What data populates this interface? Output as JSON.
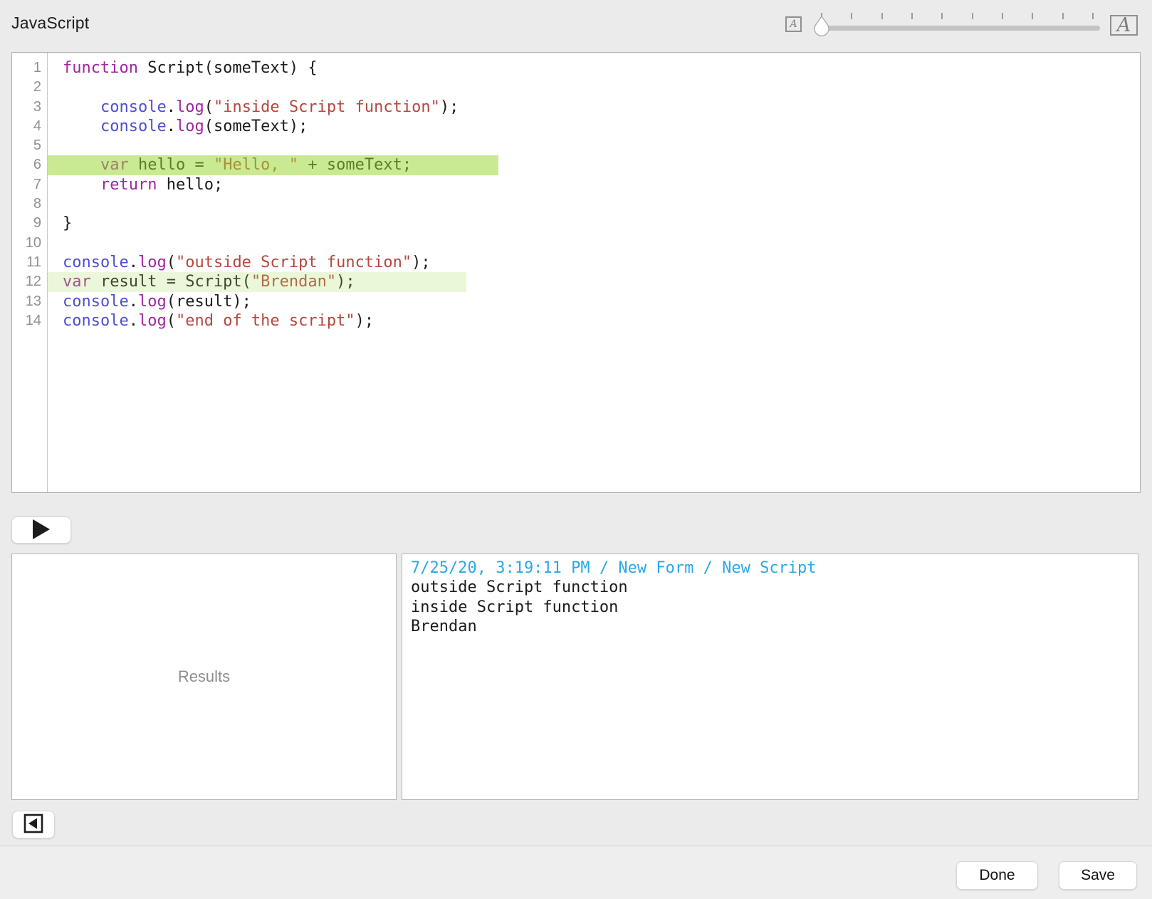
{
  "header": {
    "title": "JavaScript"
  },
  "font_slider": {
    "small_label": "A",
    "large_label": "A",
    "tick_count": 10,
    "thumb_position": "minimum"
  },
  "editor": {
    "language": "JavaScript",
    "lines": [
      {
        "segments": [
          {
            "t": "function",
            "c": "keyword"
          },
          {
            "t": " Script(someText) {",
            "c": "plain"
          }
        ]
      },
      {
        "segments": []
      },
      {
        "segments": [
          {
            "t": "    ",
            "c": "plain"
          },
          {
            "t": "console",
            "c": "builtin"
          },
          {
            "t": ".",
            "c": "plain"
          },
          {
            "t": "log",
            "c": "prop"
          },
          {
            "t": "(",
            "c": "plain"
          },
          {
            "t": "\"inside Script function\"",
            "c": "string"
          },
          {
            "t": ");",
            "c": "plain"
          }
        ]
      },
      {
        "segments": [
          {
            "t": "    ",
            "c": "plain"
          },
          {
            "t": "console",
            "c": "builtin"
          },
          {
            "t": ".",
            "c": "plain"
          },
          {
            "t": "log",
            "c": "prop"
          },
          {
            "t": "(someText);",
            "c": "plain"
          }
        ]
      },
      {
        "segments": []
      },
      {
        "highlight": "strong",
        "segments": [
          {
            "t": "    ",
            "c": "plain"
          },
          {
            "t": "var",
            "c": "keyword"
          },
          {
            "t": " hello = ",
            "c": "plain"
          },
          {
            "t": "\"Hello, \"",
            "c": "string"
          },
          {
            "t": " + someText;",
            "c": "plain"
          }
        ]
      },
      {
        "segments": [
          {
            "t": "    ",
            "c": "plain"
          },
          {
            "t": "return",
            "c": "keyword"
          },
          {
            "t": " hello;",
            "c": "plain"
          }
        ]
      },
      {
        "segments": []
      },
      {
        "segments": [
          {
            "t": "}",
            "c": "plain"
          }
        ]
      },
      {
        "segments": []
      },
      {
        "segments": [
          {
            "t": "console",
            "c": "builtin"
          },
          {
            "t": ".",
            "c": "plain"
          },
          {
            "t": "log",
            "c": "prop"
          },
          {
            "t": "(",
            "c": "plain"
          },
          {
            "t": "\"outside Script function\"",
            "c": "string"
          },
          {
            "t": ");",
            "c": "plain"
          }
        ]
      },
      {
        "highlight": "light",
        "segments": [
          {
            "t": "var",
            "c": "keyword"
          },
          {
            "t": " result = Script(",
            "c": "plain"
          },
          {
            "t": "\"Brendan\"",
            "c": "string"
          },
          {
            "t": ");",
            "c": "plain"
          }
        ]
      },
      {
        "segments": [
          {
            "t": "console",
            "c": "builtin"
          },
          {
            "t": ".",
            "c": "plain"
          },
          {
            "t": "log",
            "c": "prop"
          },
          {
            "t": "(result);",
            "c": "plain"
          }
        ]
      },
      {
        "segments": [
          {
            "t": "console",
            "c": "builtin"
          },
          {
            "t": ".",
            "c": "plain"
          },
          {
            "t": "log",
            "c": "prop"
          },
          {
            "t": "(",
            "c": "plain"
          },
          {
            "t": "\"end of the script\"",
            "c": "string"
          },
          {
            "t": ");",
            "c": "plain"
          }
        ]
      }
    ]
  },
  "toolbar": {
    "run_icon": "play-triangle"
  },
  "results_panel": {
    "label": "Results"
  },
  "output_panel": {
    "header": "7/25/20, 3:19:11 PM / New Form / New Script",
    "lines": [
      "outside Script function",
      "inside Script function",
      "Brendan"
    ]
  },
  "footer": {
    "collapse_icon": "left-triangle-in-square",
    "done_label": "Done",
    "save_label": "Save"
  },
  "colors": {
    "background": "#ECEBEB",
    "highlight_strong": "rgba(151,214,47,0.52)",
    "highlight_light": "rgba(168,224,96,0.24)",
    "syntax_keyword": "#A125A1",
    "syntax_builtin": "#4E4ED2",
    "syntax_string": "#B5473E",
    "output_header_blue": "#2AA8E8"
  }
}
